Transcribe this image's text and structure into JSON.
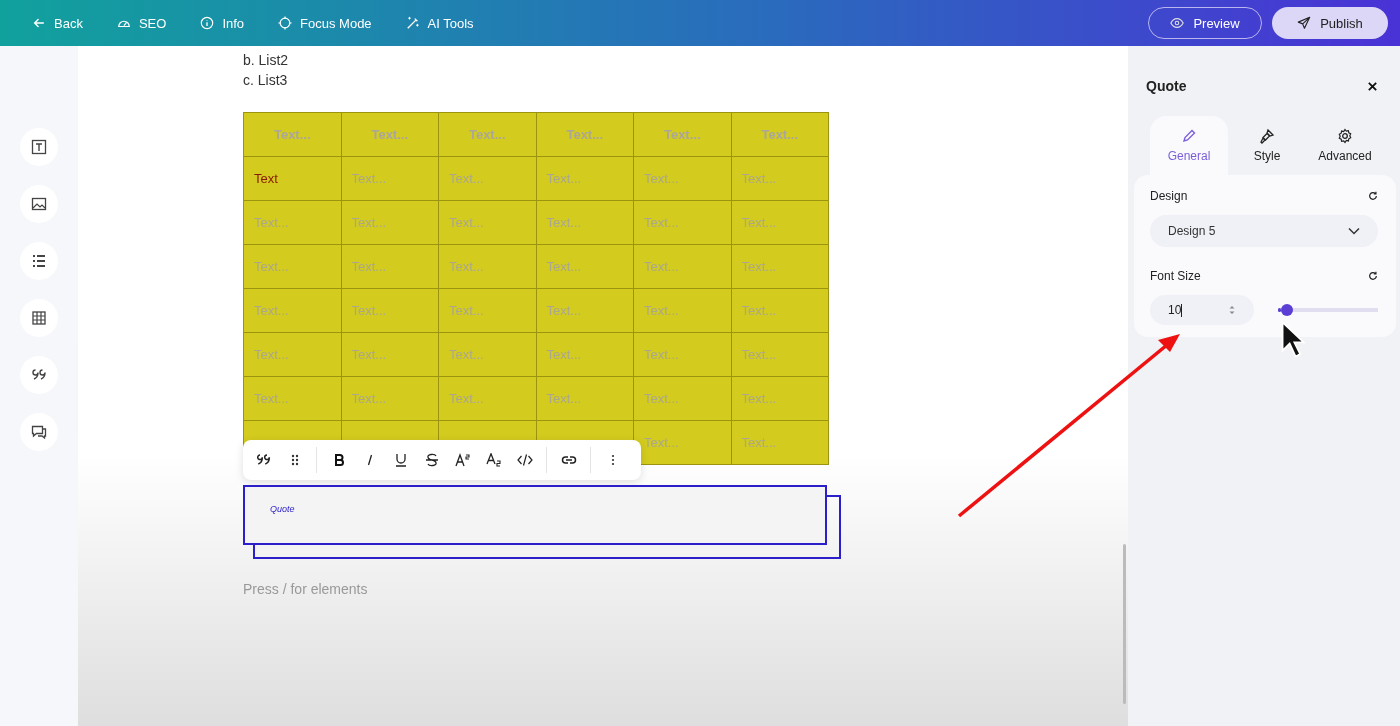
{
  "topbar": {
    "nav": [
      {
        "kind": "back",
        "label": "Back"
      },
      {
        "kind": "seo",
        "label": "SEO"
      },
      {
        "kind": "info",
        "label": "Info"
      },
      {
        "kind": "focus",
        "label": "Focus Mode"
      },
      {
        "kind": "ai",
        "label": "AI Tools"
      }
    ],
    "preview": "Preview",
    "publish": "Publish"
  },
  "sidebar": {
    "tools": [
      {
        "kind": "text"
      },
      {
        "kind": "image"
      },
      {
        "kind": "list"
      },
      {
        "kind": "table"
      },
      {
        "kind": "quote"
      },
      {
        "kind": "comment"
      }
    ]
  },
  "editor": {
    "list_items": [
      "b. List2",
      "c. List3"
    ],
    "table": {
      "header": [
        "Text...",
        "Text...",
        "Text...",
        "Text...",
        "Text...",
        "Text..."
      ],
      "rows": [
        [
          {
            "text": "Text",
            "filled": true
          },
          {
            "text": "Text...",
            "filled": false
          },
          {
            "text": "Text...",
            "filled": false
          },
          {
            "text": "Text...",
            "filled": false
          },
          {
            "text": "Text...",
            "filled": false
          },
          {
            "text": "Text...",
            "filled": false
          }
        ],
        [
          {
            "text": "Text...",
            "filled": false
          },
          {
            "text": "Text...",
            "filled": false
          },
          {
            "text": "Text...",
            "filled": false
          },
          {
            "text": "Text...",
            "filled": false
          },
          {
            "text": "Text...",
            "filled": false
          },
          {
            "text": "Text...",
            "filled": false
          }
        ],
        [
          {
            "text": "Text...",
            "filled": false
          },
          {
            "text": "Text...",
            "filled": false
          },
          {
            "text": "Text...",
            "filled": false
          },
          {
            "text": "Text...",
            "filled": false
          },
          {
            "text": "Text...",
            "filled": false
          },
          {
            "text": "Text...",
            "filled": false
          }
        ],
        [
          {
            "text": "Text...",
            "filled": false
          },
          {
            "text": "Text...",
            "filled": false
          },
          {
            "text": "Text...",
            "filled": false
          },
          {
            "text": "Text...",
            "filled": false
          },
          {
            "text": "Text...",
            "filled": false
          },
          {
            "text": "Text...",
            "filled": false
          }
        ],
        [
          {
            "text": "Text...",
            "filled": false
          },
          {
            "text": "Text...",
            "filled": false
          },
          {
            "text": "Text...",
            "filled": false
          },
          {
            "text": "Text...",
            "filled": false
          },
          {
            "text": "Text...",
            "filled": false
          },
          {
            "text": "Text...",
            "filled": false
          }
        ],
        [
          {
            "text": "Text...",
            "filled": false
          },
          {
            "text": "Text...",
            "filled": false
          },
          {
            "text": "Text...",
            "filled": false
          },
          {
            "text": "Text...",
            "filled": false
          },
          {
            "text": "Text...",
            "filled": false
          },
          {
            "text": "Text...",
            "filled": false
          }
        ],
        [
          null,
          null,
          null,
          null,
          {
            "text": "Text...",
            "filled": false
          },
          {
            "text": "Text...",
            "filled": false
          }
        ]
      ]
    },
    "toolbar": [
      {
        "kind": "quote"
      },
      {
        "kind": "drag"
      },
      {
        "kind": "sep"
      },
      {
        "kind": "bold"
      },
      {
        "kind": "italic"
      },
      {
        "kind": "underline"
      },
      {
        "kind": "strike"
      },
      {
        "kind": "sup"
      },
      {
        "kind": "sub"
      },
      {
        "kind": "code"
      },
      {
        "kind": "sep"
      },
      {
        "kind": "link"
      },
      {
        "kind": "sep"
      },
      {
        "kind": "more"
      }
    ],
    "quote": {
      "text": "Quote"
    },
    "placeholder": "Press / for elements"
  },
  "panel": {
    "title": "Quote",
    "tabs": [
      {
        "kind": "general",
        "label": "General",
        "selected": true
      },
      {
        "kind": "style",
        "label": "Style",
        "selected": false
      },
      {
        "kind": "advanced",
        "label": "Advanced",
        "selected": false
      }
    ],
    "design": {
      "label": "Design",
      "value": "Design 5"
    },
    "font_size": {
      "label": "Font Size",
      "value": "10",
      "level": 0.03
    }
  }
}
